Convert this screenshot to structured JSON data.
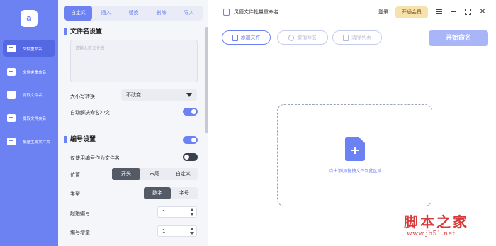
{
  "sidebar": {
    "logo_text": "a",
    "items": [
      {
        "label": "文件重命名",
        "icon": "file-icon",
        "active": true
      },
      {
        "label": "文件夹重命名",
        "icon": "folder-icon",
        "active": false
      },
      {
        "label": "提取文件名",
        "icon": "extract-icon",
        "active": false
      },
      {
        "label": "提取文件夹名",
        "icon": "folder-extract-icon",
        "active": false
      },
      {
        "label": "批量生成文件夹",
        "icon": "folder-batch-icon",
        "active": false
      }
    ]
  },
  "panel": {
    "tabs": [
      "自定义",
      "插入",
      "替换",
      "删除",
      "导入"
    ],
    "active_tab": "自定义",
    "filename_settings": {
      "title": "文件名设置",
      "placeholder": "请输入新文件名",
      "case_label": "大小写转换",
      "case_value": "不改变",
      "conflict_label": "自动解决命名冲突",
      "conflict_on": true
    },
    "numbering": {
      "title": "编号设置",
      "enabled": true,
      "only_number_label": "仅使用编号作为文件名",
      "only_number_on": false,
      "position_label": "位置",
      "position_options": [
        "开头",
        "末尾",
        "自定义"
      ],
      "position_selected": "开头",
      "type_label": "类型",
      "type_options": [
        "数字",
        "字母"
      ],
      "type_selected": "数字",
      "start_label": "起始编号",
      "start_value": "1",
      "step_label": "编号增量",
      "step_value": "1"
    }
  },
  "titlebar": {
    "app_title": "灵便文件批量重命名",
    "login": "登录",
    "vip": "开通会员"
  },
  "toolbar": {
    "add_file": "添加文件",
    "undo_rename": "撤销命名",
    "clear_list": "清除列表",
    "start": "开始命名"
  },
  "dropzone": {
    "text": "点击添加/拖拽文件到此区域"
  },
  "watermark": {
    "big": "脚本之家",
    "small": "www.jb51.net"
  },
  "colors": {
    "accent": "#6c82f3",
    "sidebar_active": "#5468e3",
    "vip_bg": "#f7e2ae",
    "start_button": "#a8b6f7",
    "watermark": "#d73b3b"
  }
}
